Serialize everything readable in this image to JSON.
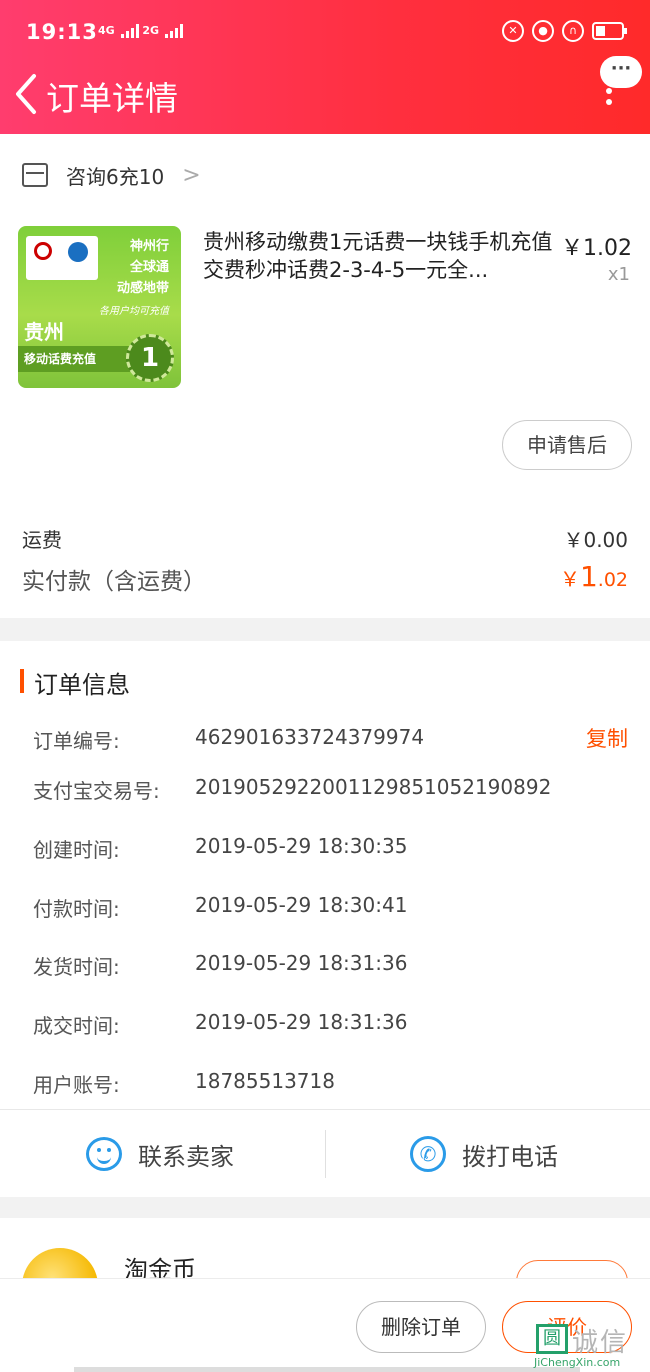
{
  "status_bar": {
    "time": "19:13",
    "network1": "4G",
    "network2": "2G"
  },
  "nav": {
    "title": "订单详情",
    "more_bubble": "···"
  },
  "shop": {
    "name": "咨询6充10"
  },
  "product": {
    "title": "贵州移动缴费1元话费一块钱手机充值交费秒冲话费2-3-4-5一元全...",
    "price": "￥1.02",
    "quantity": "x1",
    "image": {
      "slogan1": "神州行",
      "slogan2": "全球通",
      "slogan3": "动感地带",
      "subtext": "各用户均可充值",
      "province": "贵州",
      "band": "移动话费充值",
      "seal": "1"
    },
    "after_sale_label": "申请售后"
  },
  "fees": {
    "shipping_label": "运费",
    "shipping_value": "￥0.00",
    "paid_label": "实付款（含运费）",
    "paid_currency": "￥",
    "paid_integer": "1",
    "paid_decimal": ".02"
  },
  "order_info": {
    "title": "订单信息",
    "copy_label": "复制",
    "rows": [
      {
        "label": "订单编号:",
        "value": "462901633724379974"
      },
      {
        "label": "支付宝交易号:",
        "value": "2019052922001129851052190892"
      },
      {
        "label": "创建时间:",
        "value": "2019-05-29 18:30:35"
      },
      {
        "label": "付款时间:",
        "value": "2019-05-29 18:30:41"
      },
      {
        "label": "发货时间:",
        "value": "2019-05-29 18:31:36"
      },
      {
        "label": "成交时间:",
        "value": "2019-05-29 18:31:36"
      },
      {
        "label": "用户账号:",
        "value": "18785513718"
      }
    ]
  },
  "contact": {
    "seller_label": "联系卖家",
    "phone_label": "拨打电话"
  },
  "coins": {
    "title": "淘金币"
  },
  "actions": {
    "delete_label": "删除订单",
    "rate_label": "评价"
  },
  "watermark": {
    "box": "圆",
    "text": "诚信",
    "url": "JiChengXin.com"
  },
  "colors": {
    "header_start": "#ff3d6e",
    "header_end": "#ff2a2a",
    "accent": "#ff5000",
    "link_blue": "#2a9be8"
  }
}
